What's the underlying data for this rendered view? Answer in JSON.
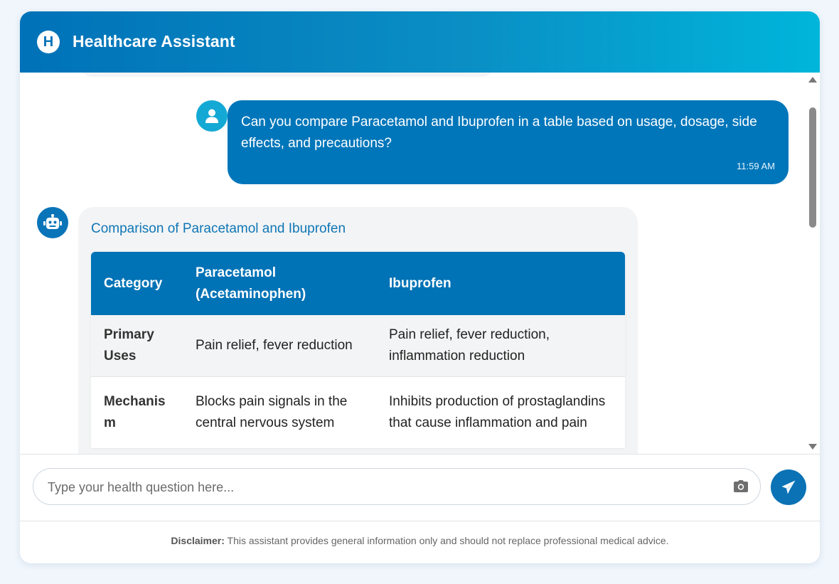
{
  "app": {
    "logo_letter": "H",
    "title": "Healthcare Assistant",
    "colors": {
      "brand": "#0072b8",
      "brand_light": "#00b5da",
      "bot_bubble": "#f3f4f5"
    }
  },
  "messages": {
    "user": {
      "avatar_icon": "user-icon",
      "text": "Can you compare Paracetamol and Ibuprofen in a table based on usage, dosage, side effects, and precautions?",
      "time": "11:59 AM"
    },
    "bot": {
      "avatar_icon": "robot-icon",
      "heading": "Comparison of Paracetamol and Ibuprofen",
      "table": {
        "headers": [
          "Category",
          "Paracetamol (Acetaminophen)",
          "Ibuprofen"
        ],
        "rows": [
          [
            "Primary Uses",
            "Pain relief, fever reduction",
            "Pain relief, fever reduction, inflammation reduction"
          ],
          [
            "Mechanism",
            "Blocks pain signals in the central nervous system",
            "Inhibits production of prostaglandins that cause inflammation and pain"
          ]
        ]
      }
    }
  },
  "composer": {
    "placeholder": "Type your health question here...",
    "camera_icon": "camera-icon",
    "send_icon": "paper-plane-icon"
  },
  "disclaimer": {
    "label": "Disclaimer:",
    "text": " This assistant provides general information only and should not replace professional medical advice."
  }
}
